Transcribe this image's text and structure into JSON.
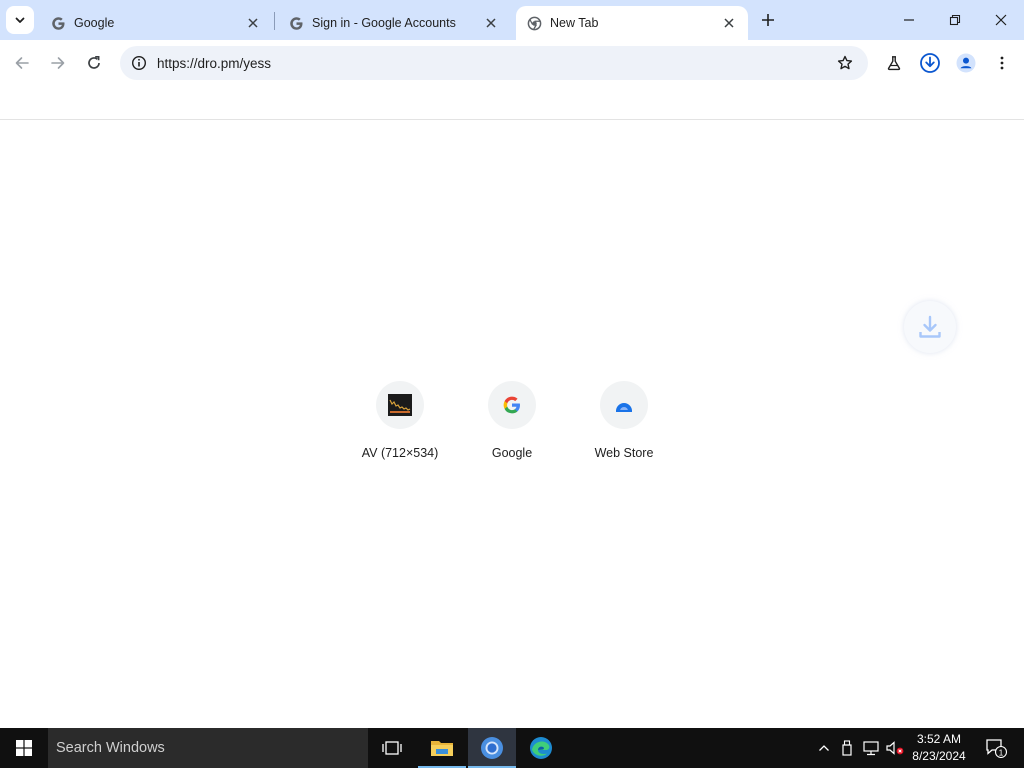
{
  "browser": {
    "tabs": [
      {
        "title": "Google",
        "favicon": "google-g-icon",
        "active": false
      },
      {
        "title": "Sign in - Google Accounts",
        "favicon": "google-g-icon",
        "active": false
      },
      {
        "title": "New Tab",
        "favicon": "chrome-globe-icon",
        "active": true
      }
    ],
    "address_bar": {
      "url": "https://dro.pm/yess"
    },
    "toolbar_icons": [
      "back-icon",
      "forward-icon",
      "reload-icon",
      "site-info-icon",
      "star-icon",
      "labs-flask-icon",
      "download-icon",
      "profile-icon",
      "menu-icon"
    ]
  },
  "new_tab": {
    "shortcuts": [
      {
        "label": "AV (712×534)",
        "icon": "av-thumbnail-icon"
      },
      {
        "label": "Google",
        "icon": "google-g-icon"
      },
      {
        "label": "Web Store",
        "icon": "web-store-icon"
      }
    ]
  },
  "taskbar": {
    "search_placeholder": "Search Windows",
    "clock": {
      "time": "3:52 AM",
      "date": "8/23/2024"
    },
    "notification_count": "1"
  },
  "colors": {
    "tabstrip": "#d3e3fd",
    "omnibox": "#eef2f9",
    "taskbar": "#101010",
    "accent": "#1a73e8"
  }
}
